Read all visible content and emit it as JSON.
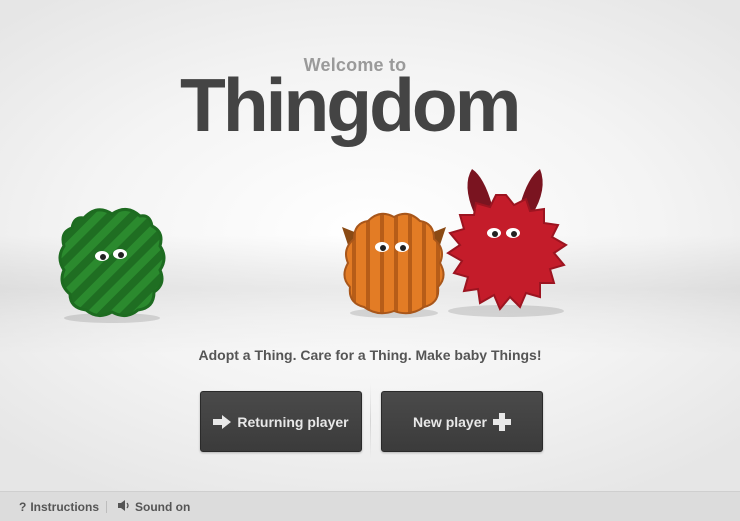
{
  "header": {
    "welcome": "Welcome to",
    "logo": "Thingdom"
  },
  "tagline": "Adopt a Thing. Care for a Thing. Make baby Things!",
  "buttons": {
    "returning_player": "Returning player",
    "new_player": "New player"
  },
  "footer": {
    "instructions": "Instructions",
    "sound": "Sound on"
  },
  "icons": {
    "returning": "arrow-right-icon",
    "new": "plus-icon",
    "instructions": "question-icon",
    "sound": "speaker-icon"
  },
  "colors": {
    "green_thing": "#2f8a32",
    "orange_thing": "#e07a24",
    "red_thing": "#c51d2a",
    "logo": "#444444",
    "button": "#3f3f3f"
  }
}
